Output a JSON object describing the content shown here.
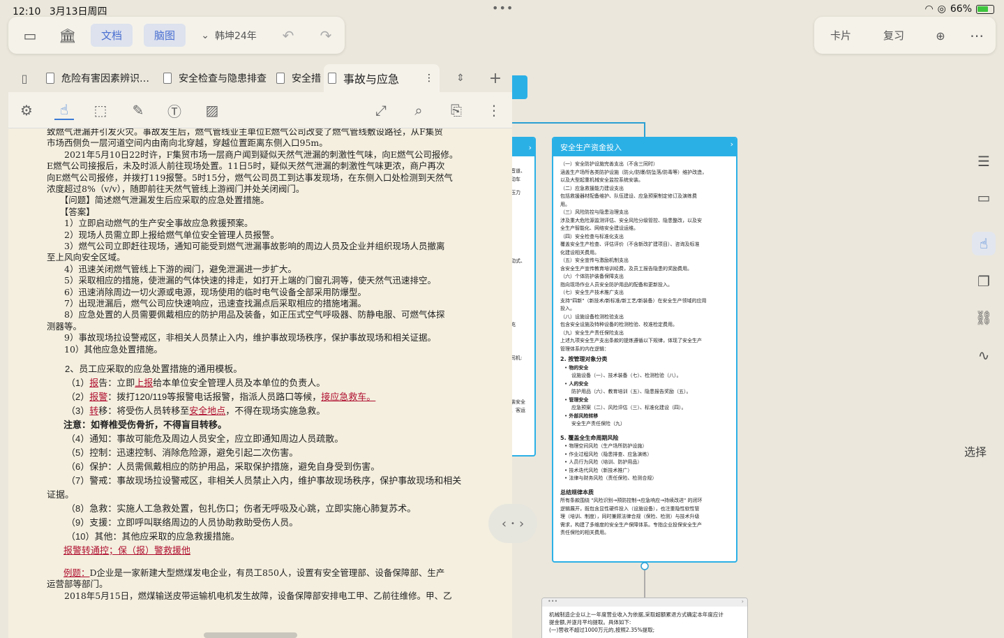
{
  "status": {
    "time": "12:10",
    "date": "3月13日周四",
    "battery": "66%"
  },
  "toolbar": {
    "doc_tab": "文档",
    "mind_tab": "脑图",
    "file_name": "韩坤24年"
  },
  "right_toolbar": {
    "card": "卡片",
    "review": "复习"
  },
  "tabs": [
    {
      "label": "危险有害因素辨识…"
    },
    {
      "label": "安全检查与隐患排查"
    },
    {
      "label": "安全措"
    },
    {
      "label": "事故与应急"
    }
  ],
  "doc": {
    "lines": [
      "致燃气泄漏并引发火灾。事故发生后，燃气管线业主单位E燃气公司改变了燃气管线敷设路径，从F集贸",
      "市场西侧负一层河道空间内由南向北穿越，穿越位置距离东侧入口95m。",
      "　　2021年5月10日22时许，F集贸市场一层商户闻到疑似天然气泄漏的刺激性气味，向E燃气公司报修。",
      "E燃气公司接报后，未及时派人前往现场处置。11日5时，疑似天然气泄漏的刺激性气味更浓，商户再次",
      "向E燃气公司报修，并拨打119报警。5时15分，燃气公司员工到达事发现场，在东侧入口处检测到天然气",
      "浓度超过8%（v/v），随即前往天然气管线上游阀门并处关闭阀门。",
      "　　【问题】简述燃气泄漏发生后应采取的应急处置措施。",
      "　　【答案】",
      "　　1）立即启动燃气的生产安全事故应急救援预案。",
      "　　2）现场人员需立即上报给燃气单位安全管理人员报警。",
      "　　3）燃气公司立即赶往现场，通知可能受到燃气泄漏事故影响的周边人员及企业并组织现场人员撤离",
      "至上风向安全区域。",
      "　　4）迅速关闭燃气管线上下游的阀门，避免泄漏进一步扩大。",
      "　　5）采取相应的措施，使泄漏的气体快速的排走，如打开上端的门窗孔洞等，使天然气迅速排空。",
      "　　6）迅速消除周边一切火源或电源，现场使用的临时电气设备全部采用防爆型。",
      "　　7）出现泄漏后，燃气公司应快速响应，迅速查找漏点后采取相应的措施堵漏。",
      "　　8）应急处置的人员需要佩戴相应的防护用品及装备，如正压式空气呼吸器、防静电服、可燃气体探",
      "测器等。",
      "　　9）事故现场拉设警戒区，非相关人员禁止入内，维护事故现场秩序，保护事故现场和相关证据。",
      "　　10）其他应急处置措施。"
    ],
    "section_title": "　　2、员工应采取的应急处置措施的通用模板。",
    "items": [
      {
        "num": "（1）",
        "key": "报",
        "rest": "告：立即",
        "u": "上报",
        "tail": "给本单位安全管理人员及本单位的负责人。"
      },
      {
        "num": "（2）",
        "key": "报警",
        "rest": "：拨打120/119等报警电话报警，指派人员路口等候，",
        "u": "接应急救车。",
        "tail": ""
      },
      {
        "num": "（3）",
        "key": "转",
        "rest": "移：将受伤人员转移至",
        "u": "安全地点",
        "tail": "，不得在现场实施急救。"
      }
    ],
    "note": "注意：如脊椎受伤骨折，不得盲目转移。",
    "items2": [
      "（4）通知：事故可能危及周边人员安全，应立即通知周边人员疏散。",
      "（5）控制：迅速控制、消除危险源，避免引起二次伤害。",
      "（6）保护：人员需佩戴相应的防护用品，采取保护措施，避免自身受到伤害。",
      "（7）警戒：事故现场拉设警戒区，非相关人员禁止入内，维护事故现场秩序，保护事故现场和相关",
      "证据。",
      "（8）急救：实施人工急救处置，包扎伤口；伤者无呼吸及心跳，立即实施心肺复苏术。",
      "（9）支援：立即呼叫联络周边的人员协助救助受伤人员。",
      "（10）其他：其他应采取的应急救援措施。"
    ],
    "mnemonic": "报警转通控；保（报）警救援他",
    "example_label": "例题：",
    "example_lines": [
      "D企业是一家新建大型燃煤发电企业，有员工850人，设置有安全管理部、设备保障部、生产",
      "运营部等部门。",
      "　　2018年5月15日，燃煤输送皮带运输机电机发生故障，设备保障部安排电工甲、乙前往维修。甲、乙"
    ]
  },
  "card_main": {
    "title": "安全生产资金投入",
    "lines": [
      "（一）安全防护设施完善支出（不含三同时）",
      "涵盖生产场所各类防护设施（防火/防爆/防坠落/防毒等）维护改造，",
      "以及大型起重机械安全监控系统安装。",
      "（二）应急救援能力建设支出",
      "包括救援器材配备维护、队伍建设、应急预案制定修订及演练费",
      "用。",
      "（三）风险防控与隐患治理支出",
      "涉及重大危险源监测评估、安全风险分级管控、隐患整改，以及安",
      "全生产智能化、网络安全建设运维。",
      "（四）安全检查与标准化支出",
      "覆盖安全生产检查、评估评价（不含新改扩建项目）、咨询及标准",
      "化建设相关费用。",
      "（五）安全宣传与激励机制支出",
      "含安全生产宣传教育培训经费，及员工报告隐患的奖励费用。",
      "（六）个体防护装备保障支出",
      "指向现场作业人员安全防护用品的配备和更新投入。",
      "（七）安全生产技术推广支出",
      "支持\"四新\"（新技术/新标准/新工艺/新装备）在安全生产领域的应用",
      "投入。",
      "（八）设施设备检测检验支出",
      "包含安全设施及特种设备的检测检验、校准检定费用。",
      "（九）安全生产责任保险支出",
      "上述九项安全生产支出条款的提炼遵循以下规律，体现了安全生产",
      "管理体系的内在逻辑："
    ],
    "h2": "2. 按管理对象分类",
    "bullets": [
      {
        "t": "物的安全",
        "d": "设施设备（一）、技术装备（七）、检测检验（八）。"
      },
      {
        "t": "人的安全",
        "d": "防护用品（六）、教育培训（五）、隐患报告奖励（五）。"
      },
      {
        "t": "管理安全",
        "d": "应急预案（二）、风险评估（三）、标准化建设（四）。"
      },
      {
        "t": "外部风险转移",
        "d": "安全生产责任保险（九）"
      }
    ],
    "h5": "5. 覆盖全生命周期风险",
    "bullets5": [
      "物理空间风险（生产场所防护设施）",
      "作业过程风险（隐患排查、应急演练）",
      "人员行为风险（培训、防护用品）",
      "技术迭代风险（新技术推广）",
      "法律与财务风险（责任保险、检测合规）"
    ],
    "summary_title": "总结规律本质",
    "summary": [
      "所有条款围绕 \"风险识别→预防控制→应急响应→持续改进\" 的闭环",
      "逻辑展开，既包含显性硬件投入（设施设备），也注重隐性软性管",
      "理（培训、制度），同时兼顾法律合规（保险、检测）与技术升级",
      "需求，构建了多维度的安全生产保障体系。专指企业投保安全生产",
      "责任保险的相关费用。"
    ]
  },
  "card_left_fragments": [
    "音道、",
    "动车",
    "压力",
    "动式、",
    "充",
    "司机:",
    "装安全",
    "、客运"
  ],
  "card_bottom": {
    "lines": [
      "机械制造企业以上一年度营业收入为依据,采取超额累退方式确定本年度应计",
      "提金额,并逐月平均提取。具体如下:",
      "(一)营收不超过1000万元的,按照2.35%提取;"
    ]
  },
  "sidebar": {
    "select": "选择"
  }
}
